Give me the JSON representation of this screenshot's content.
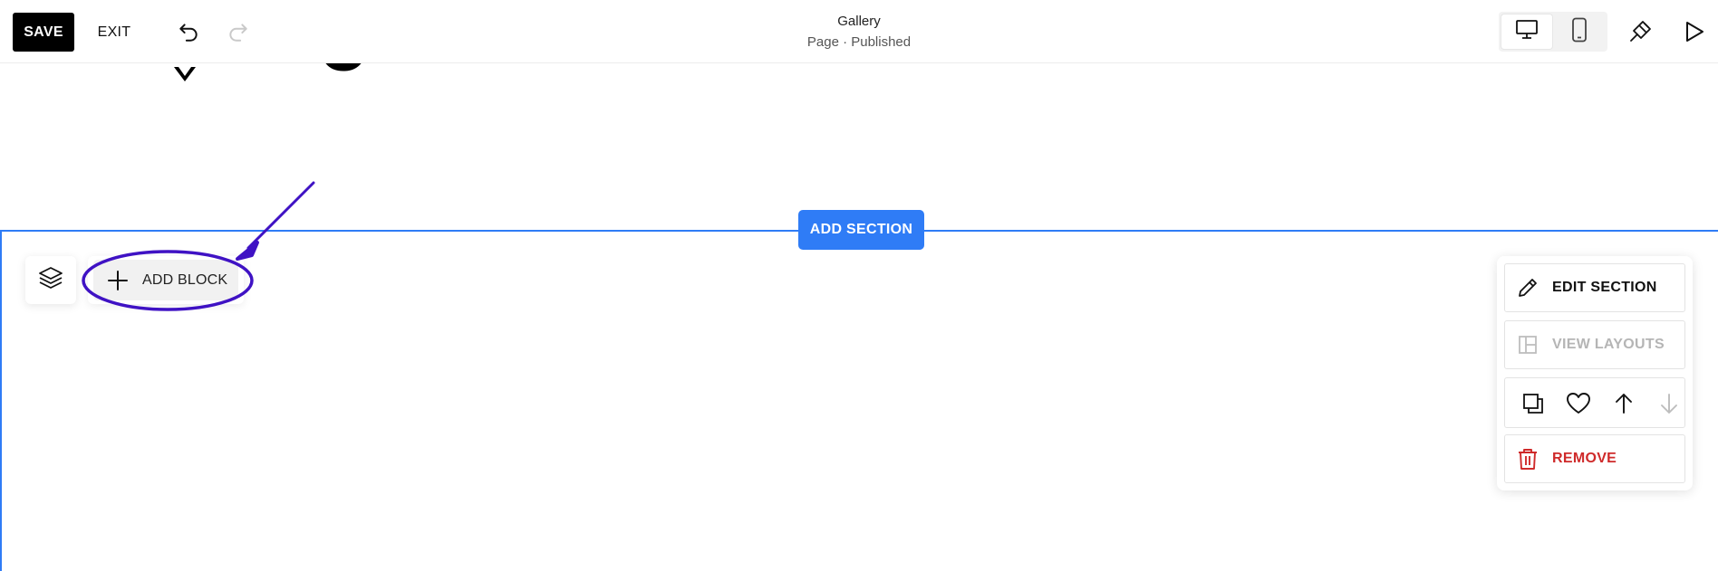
{
  "toolbar": {
    "save_label": "SAVE",
    "exit_label": "EXIT",
    "undo_icon": "undo-icon",
    "redo_icon": "redo-icon",
    "page_title": "Gallery",
    "page_status": "Page · Published",
    "device_options": [
      "desktop-icon",
      "mobile-icon"
    ],
    "selected_device": "desktop",
    "style_icon": "paintbrush-icon",
    "preview_icon": "play-icon"
  },
  "editor": {
    "add_section_label": "ADD SECTION",
    "layers_icon": "layers-icon",
    "add_block_label": "ADD BLOCK",
    "add_block_icon": "plus-icon"
  },
  "section_menu": {
    "edit_label": "EDIT SECTION",
    "view_layouts_label": "VIEW LAYOUTS",
    "view_layouts_disabled": true,
    "icons": [
      "duplicate-icon",
      "heart-icon",
      "arrow-up-icon",
      "arrow-down-icon"
    ],
    "remove_label": "REMOVE"
  },
  "colors": {
    "accent_blue": "#2f7cf6",
    "annotation_purple": "#3f12c4",
    "remove_red": "#cf2a2a",
    "disabled_gray": "#b5b5b5"
  }
}
